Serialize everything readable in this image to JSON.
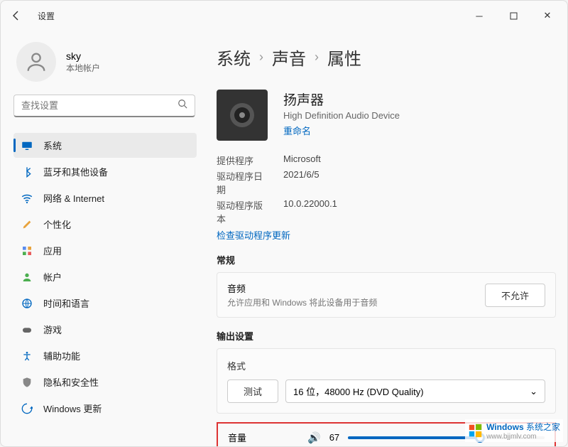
{
  "title": "设置",
  "user": {
    "name": "sky",
    "sub": "本地帐户"
  },
  "search": {
    "placeholder": "查找设置"
  },
  "nav": [
    {
      "label": "系统",
      "icon": "monitor",
      "active": true
    },
    {
      "label": "蓝牙和其他设备",
      "icon": "bluetooth"
    },
    {
      "label": "网络 & Internet",
      "icon": "wifi"
    },
    {
      "label": "个性化",
      "icon": "brush"
    },
    {
      "label": "应用",
      "icon": "apps"
    },
    {
      "label": "帐户",
      "icon": "person"
    },
    {
      "label": "时间和语言",
      "icon": "globe"
    },
    {
      "label": "游戏",
      "icon": "game"
    },
    {
      "label": "辅助功能",
      "icon": "accessibility"
    },
    {
      "label": "隐私和安全性",
      "icon": "shield"
    },
    {
      "label": "Windows 更新",
      "icon": "update"
    }
  ],
  "breadcrumb": [
    "系统",
    "声音",
    "属性"
  ],
  "device": {
    "title": "扬声器",
    "sub": "High Definition Audio Device",
    "rename": "重命名"
  },
  "props": {
    "provider_label": "提供程序",
    "provider": "Microsoft",
    "date_label": "驱动程序日期",
    "date": "2021/6/5",
    "ver_label": "驱动程序版本",
    "ver": "10.0.22000.1",
    "update": "检查驱动程序更新"
  },
  "general": {
    "title": "常规",
    "audio_label": "音频",
    "audio_sub": "允许应用和 Windows 将此设备用于音频",
    "deny": "不允许"
  },
  "output": {
    "title": "输出设置",
    "format_label": "格式",
    "test": "测试",
    "format_value": "16 位，48000 Hz (DVD Quality)",
    "volume_label": "音量",
    "volume": 67
  },
  "watermark": {
    "brand": "Windows",
    "text": "系统之家",
    "url": "www.bjjmlv.com"
  }
}
